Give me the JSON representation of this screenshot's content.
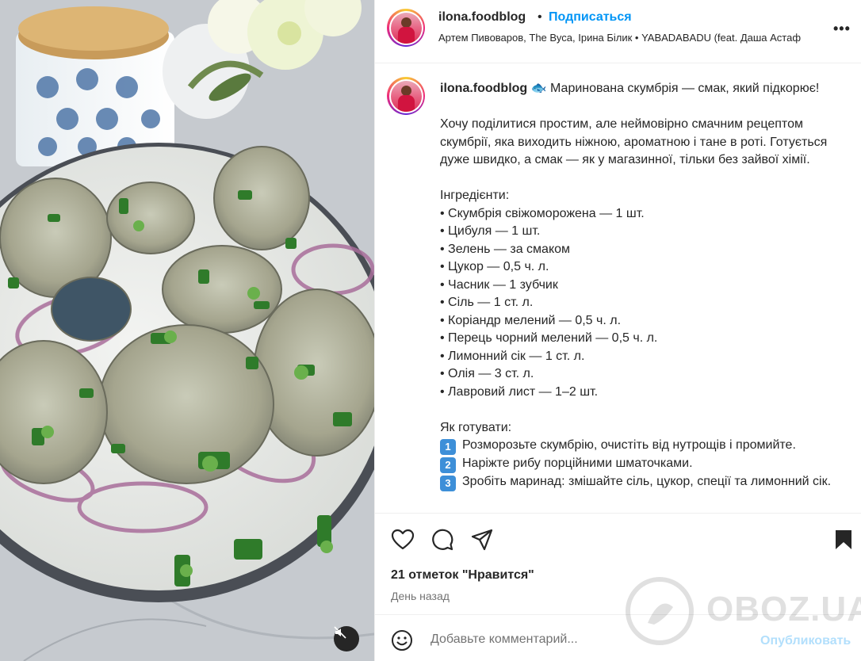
{
  "post": {
    "username": "ilona.foodblog",
    "follow_label": "Подписаться",
    "separator": "•",
    "audio": "Артем Пивоваров, The Вуса, Ірина Білик • YABADABADU (feat. Даша Астаф",
    "more_label": "•••"
  },
  "caption": {
    "username": "ilona.foodblog",
    "emoji": "🐟",
    "title": "Маринована скумбрія — смак, який підкорює!",
    "intro": "Хочу поділитися простим, але неймовірно смачним рецептом скумбрії, яка виходить ніжною, ароматною і тане в роті. Готується дуже швидко, а смак — як у магазинної, тільки без зайвої хімії.",
    "ingredients_heading": "Інгредієнти:",
    "ingredients": [
      "• Скумбрія свіжоморожена — 1 шт.",
      "• Цибуля — 1 шт.",
      "• Зелень — за смаком",
      "• Цукор — 0,5 ч. л.",
      "• Часник — 1 зубчик",
      "• Сіль — 1 ст. л.",
      "• Коріандр мелений — 0,5 ч. л.",
      "• Перець чорний мелений — 0,5 ч. л.",
      "• Лимонний сік — 1 ст. л.",
      "• Олія — 3 ст. л.",
      "• Лавровий лист — 1–2 шт."
    ],
    "steps_heading": "Як готувати:",
    "steps": [
      {
        "num": "1",
        "text": "Розморозьте скумбрію, очистіть від нутрощів і промийте."
      },
      {
        "num": "2",
        "text": "Наріжте рибу порційними шматочками."
      },
      {
        "num": "3",
        "text": "Зробіть маринад: змішайте сіль, цукор, спеції та лимонний сік."
      }
    ]
  },
  "actions": {
    "likes": "21 отметок \"Нравится\"",
    "time": "День назад",
    "comment_placeholder": "Добавьте комментарий...",
    "post_label": "Опубликовать"
  },
  "watermark": "OBOZ.UA",
  "colors": {
    "link_blue": "#0095f6",
    "post_disabled": "#b2dffc",
    "text": "#262626",
    "secondary": "#737373"
  }
}
